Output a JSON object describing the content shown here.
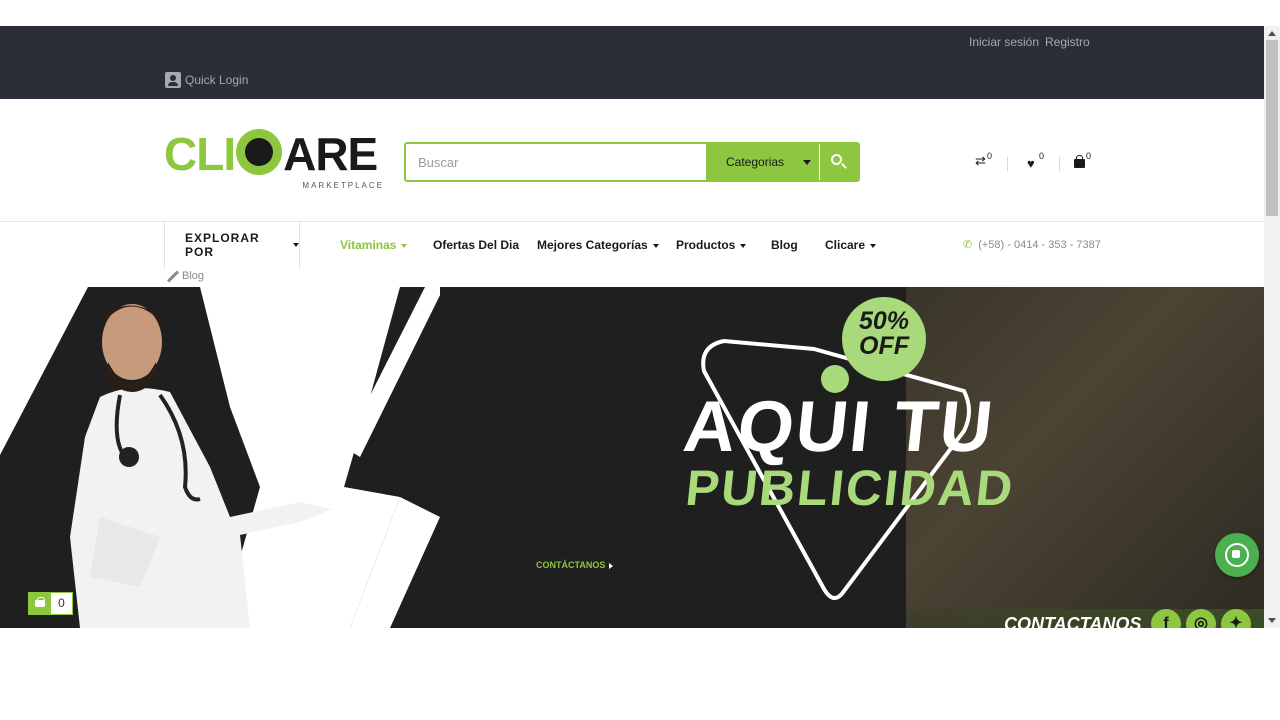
{
  "topbar": {
    "login_label": "Iniciar sesión",
    "register_label": "Registro",
    "quick_login_label": "Quick Login"
  },
  "header": {
    "logo_text_a": "CLI",
    "logo_text_b": "ARE",
    "logo_sub": "MARKETPLACE",
    "search_placeholder": "Buscar",
    "categories_label": "Categorias",
    "compare_count": "0",
    "wishlist_count": "0",
    "cart_count": "0"
  },
  "nav": {
    "explore_label": "EXPLORAR POR",
    "items": [
      {
        "label": "Vitaminas",
        "dropdown": true,
        "active": true
      },
      {
        "label": "Ofertas Del Dia",
        "dropdown": false
      },
      {
        "label": "Mejores Categorías",
        "dropdown": true
      },
      {
        "label": "Productos",
        "dropdown": true
      },
      {
        "label": "Blog",
        "dropdown": false
      },
      {
        "label": "Clicare",
        "dropdown": true
      }
    ],
    "phone": "(+58) - 0414 - 353 - 7387",
    "blog_mini": "Blog"
  },
  "banner": {
    "offer_line1": "50%",
    "offer_line2": "OFF",
    "headline1": "AQUI TU",
    "headline2": "PUBLICIDAD",
    "cta": "CONTÁCTANOS",
    "contact_label": "CONTACTANOS",
    "social": [
      "f",
      "ig",
      "tw"
    ]
  },
  "floating": {
    "cart_count": "0"
  },
  "colors": {
    "accent": "#8dc63f",
    "topbar_bg": "#2a2e38",
    "banner_bg": "#1f1f1f"
  }
}
